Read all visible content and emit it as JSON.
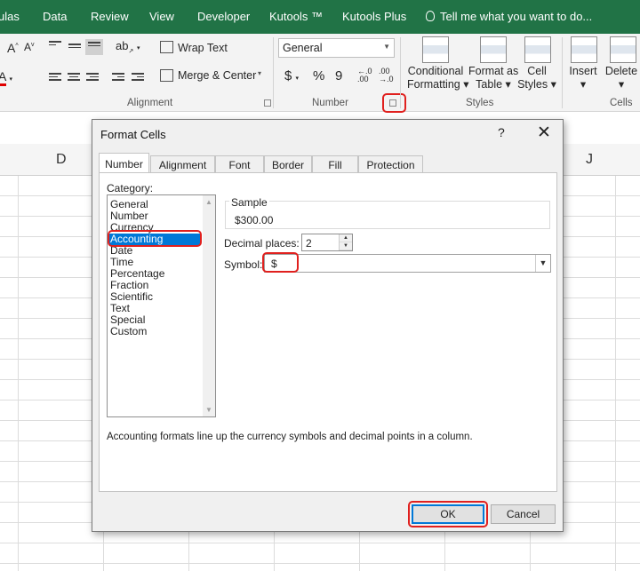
{
  "menu": {
    "items": [
      "ulas",
      "Data",
      "Review",
      "View",
      "Developer",
      "Kutools ™",
      "Kutools Plus"
    ],
    "tell_me": "Tell me what you want to do..."
  },
  "ribbon": {
    "wrap_text": "Wrap Text",
    "merge_center": "Merge & Center",
    "number_format": "General",
    "currency_symbol": "$",
    "percent_symbol": "%",
    "comma_symbol": "9",
    "conditional_formatting": [
      "Conditional",
      "Formatting"
    ],
    "format_as_table": [
      "Format as",
      "Table"
    ],
    "cell_styles": [
      "Cell",
      "Styles"
    ],
    "insert": "Insert",
    "delete": "Delete",
    "group_alignment": "Alignment",
    "group_number": "Number",
    "group_styles": "Styles",
    "group_cells": "Cells",
    "font_color_letter": "A"
  },
  "sheet": {
    "columns": [
      "D",
      "J"
    ]
  },
  "dialog": {
    "title": "Format Cells",
    "help": "?",
    "close": "✕",
    "tabs": [
      "Number",
      "Alignment",
      "Font",
      "Border",
      "Fill",
      "Protection"
    ],
    "category_label": "Category:",
    "categories": [
      "General",
      "Number",
      "Currency",
      "Accounting",
      "Date",
      "Time",
      "Percentage",
      "Fraction",
      "Scientific",
      "Text",
      "Special",
      "Custom"
    ],
    "selected_category": "Accounting",
    "sample_label": "Sample",
    "sample_value": "$300.00",
    "decimal_places_label": "Decimal places:",
    "decimal_places_value": "2",
    "symbol_label": "Symbol:",
    "symbol_value": "$",
    "description": "Accounting formats line up the currency symbols and decimal points in a column.",
    "ok_label": "OK",
    "cancel_label": "Cancel"
  },
  "colors": {
    "excel_green": "#217346",
    "highlight_red": "#e0201e",
    "selection_blue": "#0078d7"
  }
}
